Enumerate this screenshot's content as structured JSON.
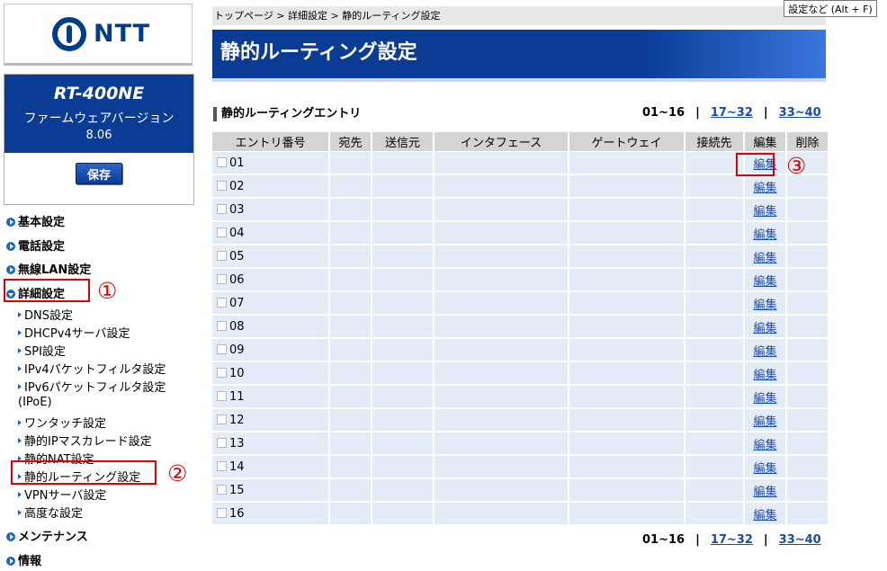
{
  "tooltip": "設定など (Alt + F)",
  "brand": {
    "logo_text": "NTT"
  },
  "device": {
    "model": "RT-400NE",
    "firmware_label": "ファームウェアバージョン",
    "firmware_version": "8.06",
    "save_label": "保存"
  },
  "nav": {
    "basic": "基本設定",
    "phone": "電話設定",
    "wlan": "無線LAN設定",
    "detail": "詳細設定",
    "sub_items": [
      "DNS設定",
      "DHCPv4サーバ設定",
      "SPI設定",
      "IPv4パケットフィルタ設定",
      "IPv6パケットフィルタ設定",
      "(IPoE)",
      "ワンタッチ設定",
      "静的IPマスカレード設定",
      "静的NAT設定",
      "静的ルーティング設定",
      "VPNサーバ設定",
      "高度な設定"
    ],
    "maintenance": "メンテナンス",
    "info": "情報"
  },
  "annotations": {
    "one": "①",
    "two": "②",
    "three": "③"
  },
  "breadcrumb": "トップページ > 詳細設定 > 静的ルーティング設定",
  "page_title": "静的ルーティング設定",
  "section_title": "静的ルーティングエントリ",
  "pager": {
    "current": "01~16",
    "sep": "|",
    "page2": "17~32",
    "page3": "33~40"
  },
  "table": {
    "headers": [
      "エントリ番号",
      "宛先",
      "送信元",
      "インタフェース",
      "ゲートウェイ",
      "接続先",
      "編集",
      "削除"
    ],
    "edit_label": "編集",
    "rows": [
      "01",
      "02",
      "03",
      "04",
      "05",
      "06",
      "07",
      "08",
      "09",
      "10",
      "11",
      "12",
      "13",
      "14",
      "15",
      "16"
    ]
  },
  "colors": {
    "brand_blue": "#0a3c96",
    "annotation_red": "#e00000",
    "link_blue": "#1a4cb0"
  }
}
